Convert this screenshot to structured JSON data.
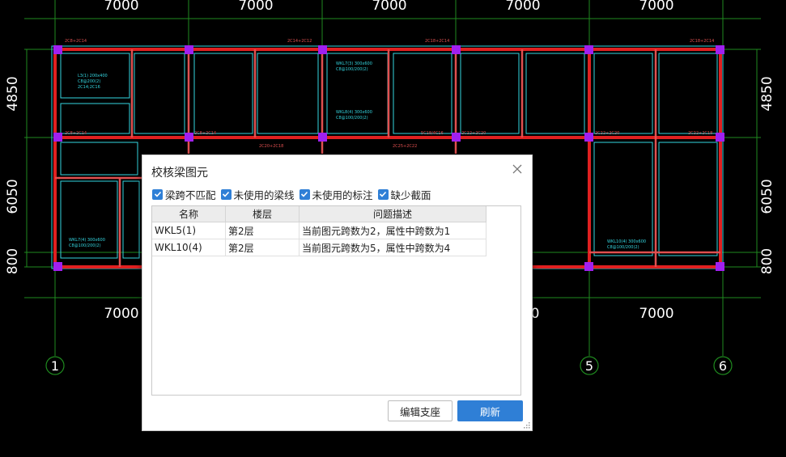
{
  "drawing": {
    "top_dims": [
      "7000",
      "7000",
      "7000",
      "7000",
      "7000"
    ],
    "bottom_dims": [
      "7000",
      "0",
      "7000"
    ],
    "left_dims": [
      "4850",
      "6050",
      "800"
    ],
    "right_dims": [
      "4850",
      "6050",
      "800"
    ],
    "axis_labels": [
      "1",
      "5",
      "6"
    ]
  },
  "dialog": {
    "title": "校核梁图元",
    "checks": [
      {
        "label": "梁跨不匹配",
        "checked": true
      },
      {
        "label": "未使用的梁线",
        "checked": true
      },
      {
        "label": "未使用的标注",
        "checked": true
      },
      {
        "label": "缺少截面",
        "checked": true
      }
    ],
    "table": {
      "headers": [
        "名称",
        "楼层",
        "问题描述"
      ],
      "rows": [
        [
          "WKL5(1)",
          "第2层",
          "当前图元跨数为2，属性中跨数为1"
        ],
        [
          "WKL10(4)",
          "第2层",
          "当前图元跨数为5，属性中跨数为4"
        ]
      ]
    },
    "edit_button": "编辑支座",
    "refresh_button": "刷新"
  }
}
